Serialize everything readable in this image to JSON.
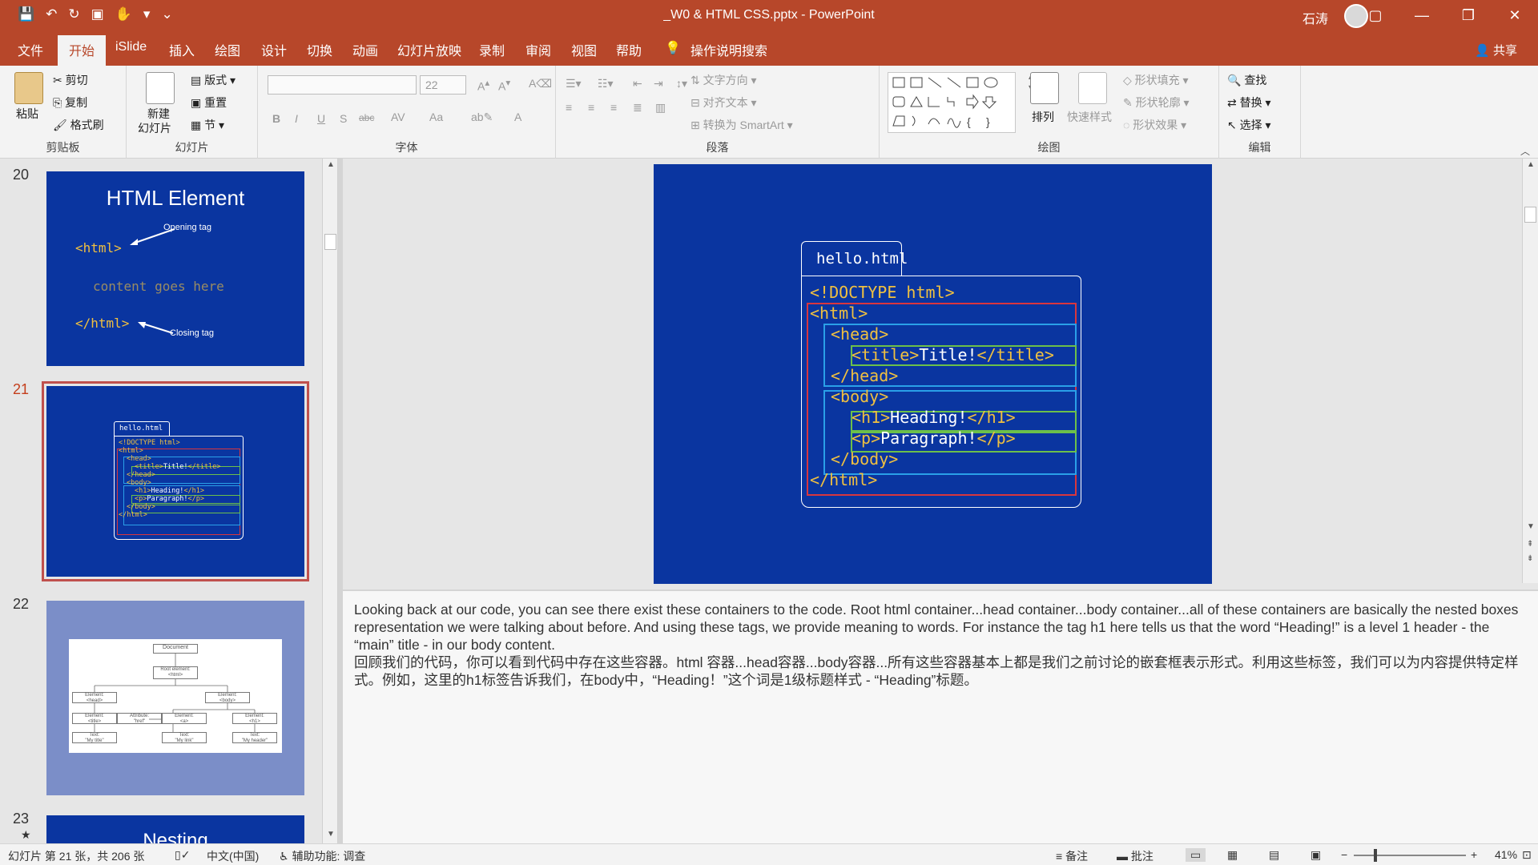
{
  "app": {
    "doc_title": "_W0 & HTML CSS.pptx  -  PowerPoint",
    "user_name": "石涛",
    "share_label": "共享"
  },
  "qat": [
    "💾",
    "↶",
    "↻",
    "▣",
    "✋",
    "▾",
    "⌄"
  ],
  "window_controls": [
    "▢",
    "—",
    "❐",
    "✕"
  ],
  "tabs": [
    "文件",
    "开始",
    "iSlide",
    "插入",
    "绘图",
    "设计",
    "切换",
    "动画",
    "幻灯片放映",
    "录制",
    "审阅",
    "视图",
    "帮助",
    "操作说明搜索"
  ],
  "ribbon": {
    "clipboard": {
      "label": "剪贴板",
      "paste": "粘贴",
      "cut": "剪切",
      "copy": "复制",
      "format_painter": "格式刷"
    },
    "slides": {
      "label": "幻灯片",
      "new_slide_1": "新建",
      "new_slide_2": "幻灯片",
      "layout": "版式",
      "reset": "重置",
      "section": "节"
    },
    "font": {
      "label": "字体",
      "size_value": "22",
      "buttons": [
        "B",
        "I",
        "U",
        "S",
        "abc",
        "AV",
        "Aa",
        "A"
      ]
    },
    "paragraph": {
      "label": "段落",
      "text_direction": "文字方向",
      "align_text": "对齐文本",
      "smartart": "转换为 SmartArt"
    },
    "drawing": {
      "label": "绘图",
      "arrange": "排列",
      "quick_styles": "快速样式",
      "fill": "形状填充",
      "outline": "形状轮廓",
      "effects": "形状效果"
    },
    "editing": {
      "label": "编辑",
      "find": "查找",
      "replace": "替换",
      "select": "选择"
    }
  },
  "thumbnails": [
    {
      "num": "20",
      "title": "HTML Element",
      "open_tag": "<html>",
      "open_label": "Opening tag",
      "content": "content goes here",
      "close_tag": "</html>",
      "close_label": "Closing tag"
    },
    {
      "num": "21"
    },
    {
      "num": "22",
      "document": "Document",
      "root": "Root element:",
      "root_tag": "<html>",
      "head": "Element:",
      "head_tag": "<head>",
      "body": "Element:",
      "body_tag": "<body>",
      "title_el": "Element:",
      "title_tag": "<title>",
      "attr": "Attribute:",
      "attr_val": "\"href\"",
      "a_el": "Element:",
      "a_tag": "<a>",
      "h1_el": "Element:",
      "h1_tag": "<h1>",
      "text1": "Text:",
      "text1_val": "\"My title\"",
      "text2": "Text:",
      "text2_val": "\"My link\"",
      "text3": "Text:",
      "text3_val": "\"My header\""
    },
    {
      "num": "23",
      "title": "Nesting",
      "star": "★"
    }
  ],
  "slide": {
    "tab_label": "hello.html",
    "lines": [
      {
        "indent": 0,
        "kw": "<!DOCTYPE html>",
        "text": "",
        "close": ""
      },
      {
        "indent": 0,
        "kw": "<html>",
        "text": "",
        "close": ""
      },
      {
        "indent": 1,
        "kw": "<head>",
        "text": "",
        "close": ""
      },
      {
        "indent": 2,
        "kw": "<title>",
        "text": "Title!",
        "close": "</title>"
      },
      {
        "indent": 1,
        "kw": "</head>",
        "text": "",
        "close": ""
      },
      {
        "indent": 1,
        "kw": "<body>",
        "text": "",
        "close": ""
      },
      {
        "indent": 2,
        "kw": "<h1>",
        "text": "Heading!",
        "close": "</h1>"
      },
      {
        "indent": 2,
        "kw": "<p>",
        "text": "Paragraph!",
        "close": "</p>"
      },
      {
        "indent": 1,
        "kw": "</body>",
        "text": "",
        "close": ""
      },
      {
        "indent": 0,
        "kw": "</html>",
        "text": "",
        "close": ""
      }
    ]
  },
  "notes": {
    "en": "Looking back at our code, you can see there exist these containers to the code. Root html container...head container...body container...all of these containers are basically the nested boxes representation we were talking about before. And using these tags, we provide meaning to words. For instance the tag h1 here tells us that the word “Heading!” is a level 1 header - the “main” title - in our body content.",
    "zh": "回顾我们的代码，你可以看到代码中存在这些容器。html 容器...head容器...body容器...所有这些容器基本上都是我们之前讨论的嵌套框表示形式。利用这些标签，我们可以为内容提供特定样式。例如，这里的h1标签告诉我们，在body中，“Heading！”这个词是1级标题样式 - “Heading”标题。"
  },
  "status": {
    "slide_info": "幻灯片 第 21 张，共 206 张",
    "language": "中文(中国)",
    "accessibility": "辅助功能: 调查",
    "notes_btn": "备注",
    "comments_btn": "批注",
    "zoom": "41%"
  },
  "colors": {
    "accent": "#b7472a",
    "slide_bg": "#0a35a0",
    "red_box": "#d9363e",
    "blue_box": "#2aa0e8",
    "green_box": "#6cc04a",
    "tag": "#f0c040"
  }
}
